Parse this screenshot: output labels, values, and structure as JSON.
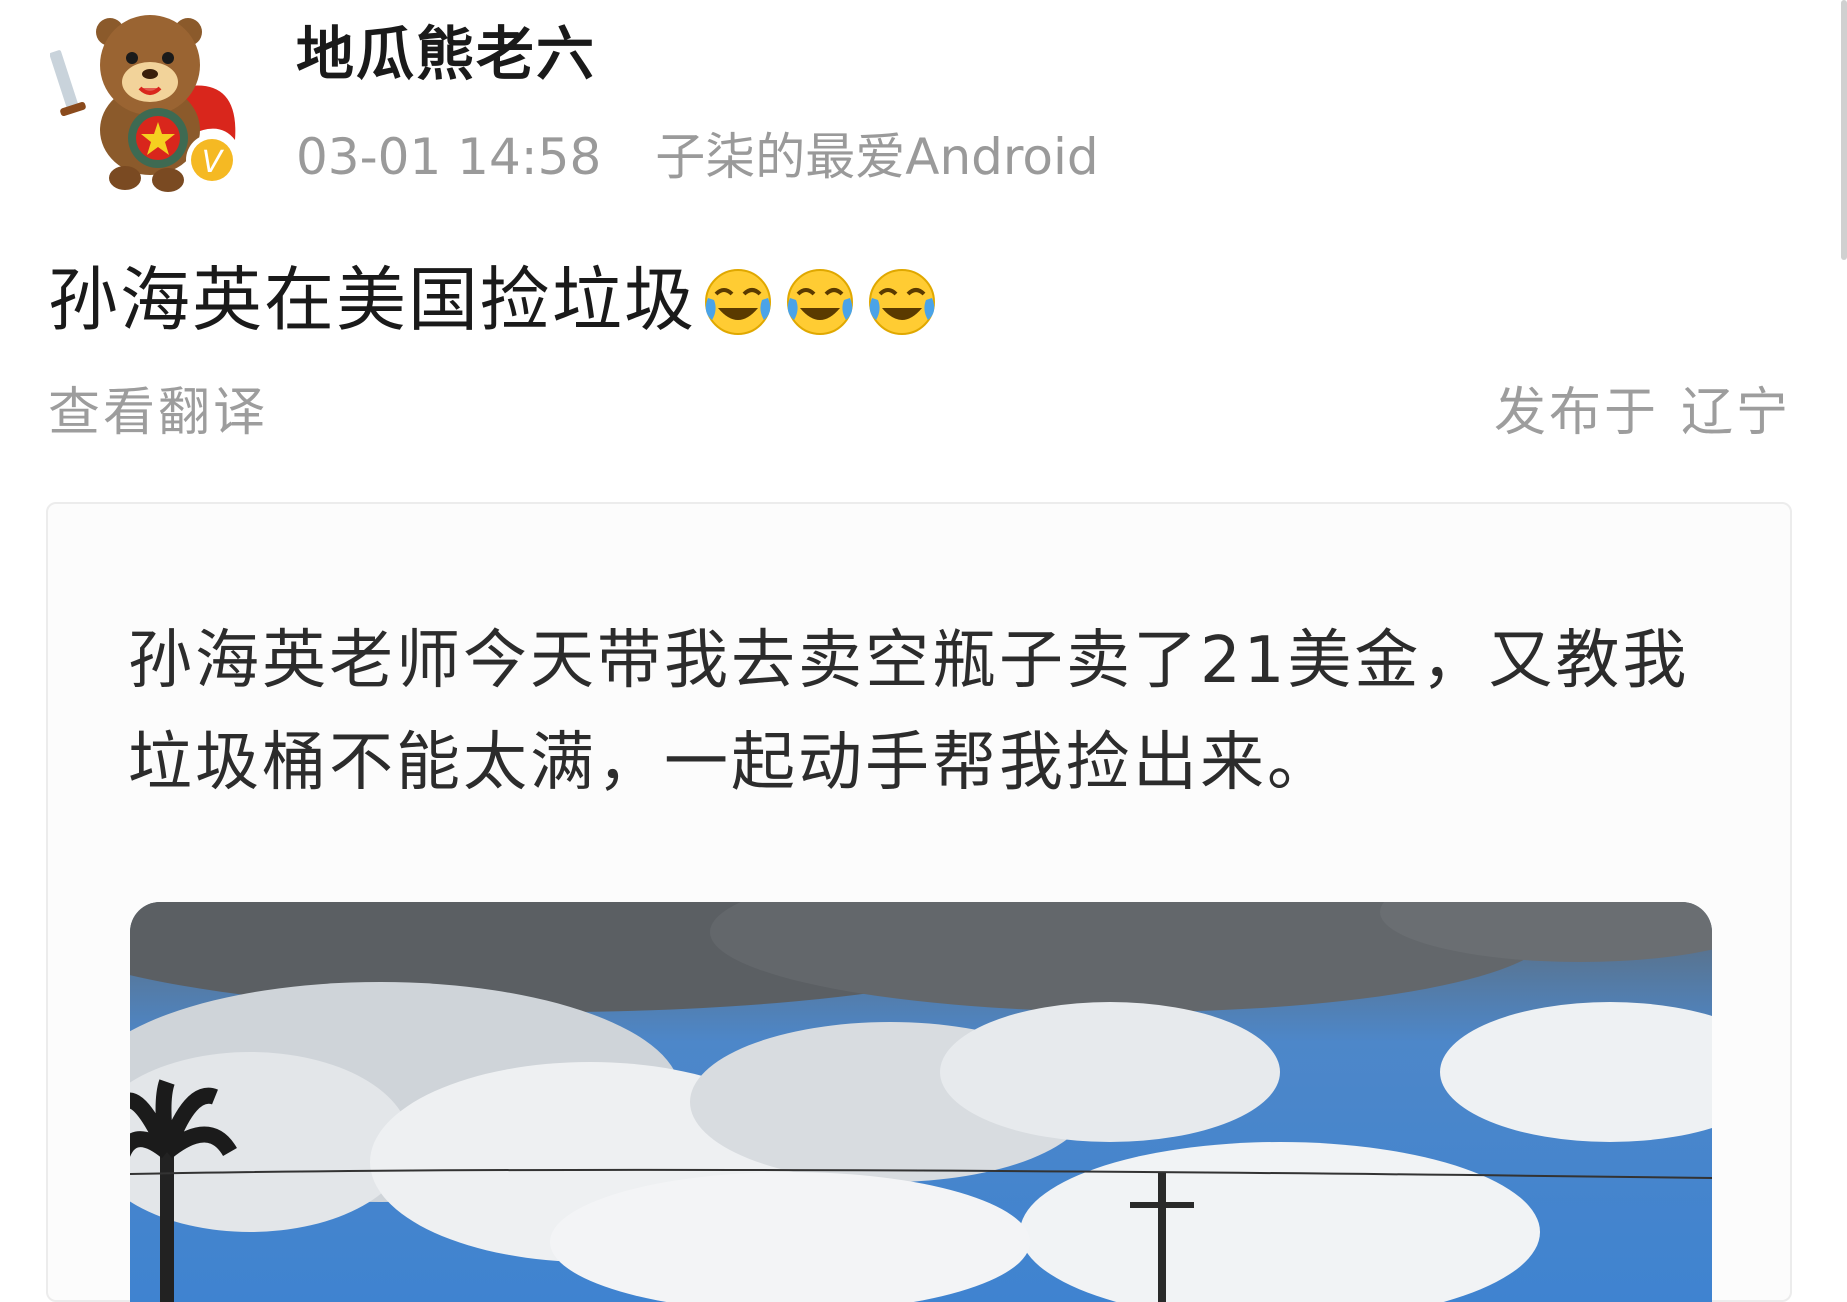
{
  "post": {
    "username": "地瓜熊老六",
    "timestamp": "03-01 14:58",
    "source": "子柒的最爱Android",
    "text": "孙海英在美国捡垃圾",
    "emoji": [
      "laughing-crying-emoji",
      "laughing-crying-emoji",
      "laughing-crying-emoji"
    ],
    "translate_label": "查看翻译",
    "published_label": "发布于",
    "location": "辽宁"
  },
  "card": {
    "text": "孙海英老师今天带我去卖空瓶子卖了21美金，又教我垃圾桶不能太满，一起动手帮我捡出来。"
  },
  "avatar": {
    "verified_badge": "V"
  },
  "colors": {
    "meta_gray": "#9a9a9a",
    "badge_gold": "#f5b923",
    "sky_blue": "#3f83d0"
  }
}
